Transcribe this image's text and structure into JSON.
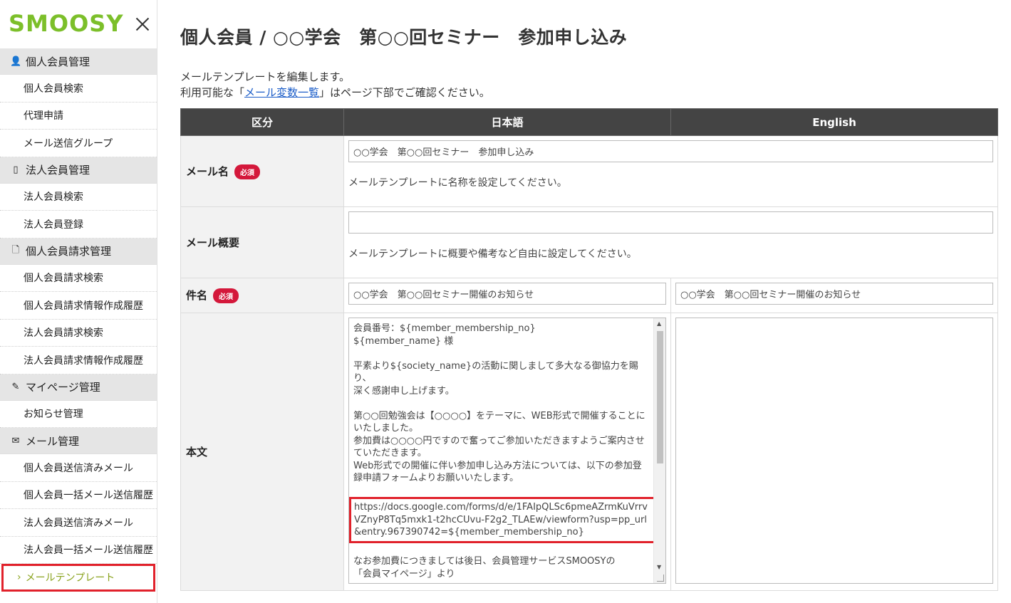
{
  "brand": {
    "logo_text": "SMOOSY"
  },
  "sidebar": {
    "sections": [
      {
        "icon": "person-icon",
        "glyph": "👤",
        "label": "個人会員管理",
        "items": [
          "個人会員検索",
          "代理申請",
          "メール送信グループ"
        ]
      },
      {
        "icon": "building-icon",
        "glyph": "▯",
        "label": "法人会員管理",
        "items": [
          "法人会員検索",
          "法人会員登録"
        ]
      },
      {
        "icon": "document-icon",
        "glyph": "🗋",
        "label": "個人会員請求管理",
        "items": [
          "個人会員請求検索",
          "個人会員請求情報作成履歴",
          "法人会員請求検索",
          "法人会員請求情報作成履歴"
        ]
      },
      {
        "icon": "pen-icon",
        "glyph": "✎",
        "label": "マイページ管理",
        "items": [
          "お知らせ管理"
        ]
      },
      {
        "icon": "mail-icon",
        "glyph": "✉",
        "label": "メール管理",
        "items": [
          "個人会員送信済みメール",
          "個人会員一括メール送信履歴",
          "法人会員送信済みメール",
          "法人会員一括メール送信履歴"
        ]
      }
    ],
    "active_item": "メールテンプレート",
    "active_chevron": "›"
  },
  "page": {
    "title": "個人会員 / ○○学会　第○○回セミナー　参加申し込み",
    "desc_line1": "メールテンプレートを編集します。",
    "desc_line2_pre": "利用可能な「",
    "desc_link": "メール変数一覧",
    "desc_line2_post": "」はページ下部でご確認ください。"
  },
  "table": {
    "headers": {
      "category": "区分",
      "japanese": "日本語",
      "english": "English"
    },
    "required_badge": "必須",
    "mail_name": {
      "label": "メール名",
      "value": "○○学会　第○○回セミナー　参加申し込み",
      "hint": "メールテンプレートに名称を設定してください。"
    },
    "mail_summary": {
      "label": "メール概要",
      "value": "",
      "hint": "メールテンプレートに概要や備考など自由に設定してください。"
    },
    "subject": {
      "label": "件名",
      "value_ja": "○○学会　第○○回セミナー開催のお知らせ",
      "value_en": "○○学会　第○○回セミナー開催のお知らせ"
    },
    "body": {
      "label": "本文",
      "lines_before": [
        "会員番号：${member_membership_no}",
        "${member_name} 様",
        "",
        "平素より${society_name}の活動に関しまして多大なる御協力を賜り、",
        "深く感謝申し上げます。",
        "",
        "第○○回勉強会は【○○○○】をテーマに、WEB形式で開催することにいたしました。",
        "参加費は○○○○円ですので奮ってご参加いただきますようご案内させていただきます。",
        "Web形式での開催に伴い参加申し込み方法については、以下の参加登録申請フォームよりお願いいたします。",
        ""
      ],
      "url": "https://docs.google.com/forms/d/e/1FAIpQLSc6pmeAZrmKuVrrvVZnyP8Tq5mxk1-t2hcCUvu-F2g2_TLAEw/viewform?usp=pp_url&entry.967390742=${member_membership_no}",
      "lines_after": [
        "",
        "なお参加費につきましては後日、会員管理サービスSMOOSYの",
        "「会員マイページ」より"
      ],
      "value_en": ""
    }
  }
}
